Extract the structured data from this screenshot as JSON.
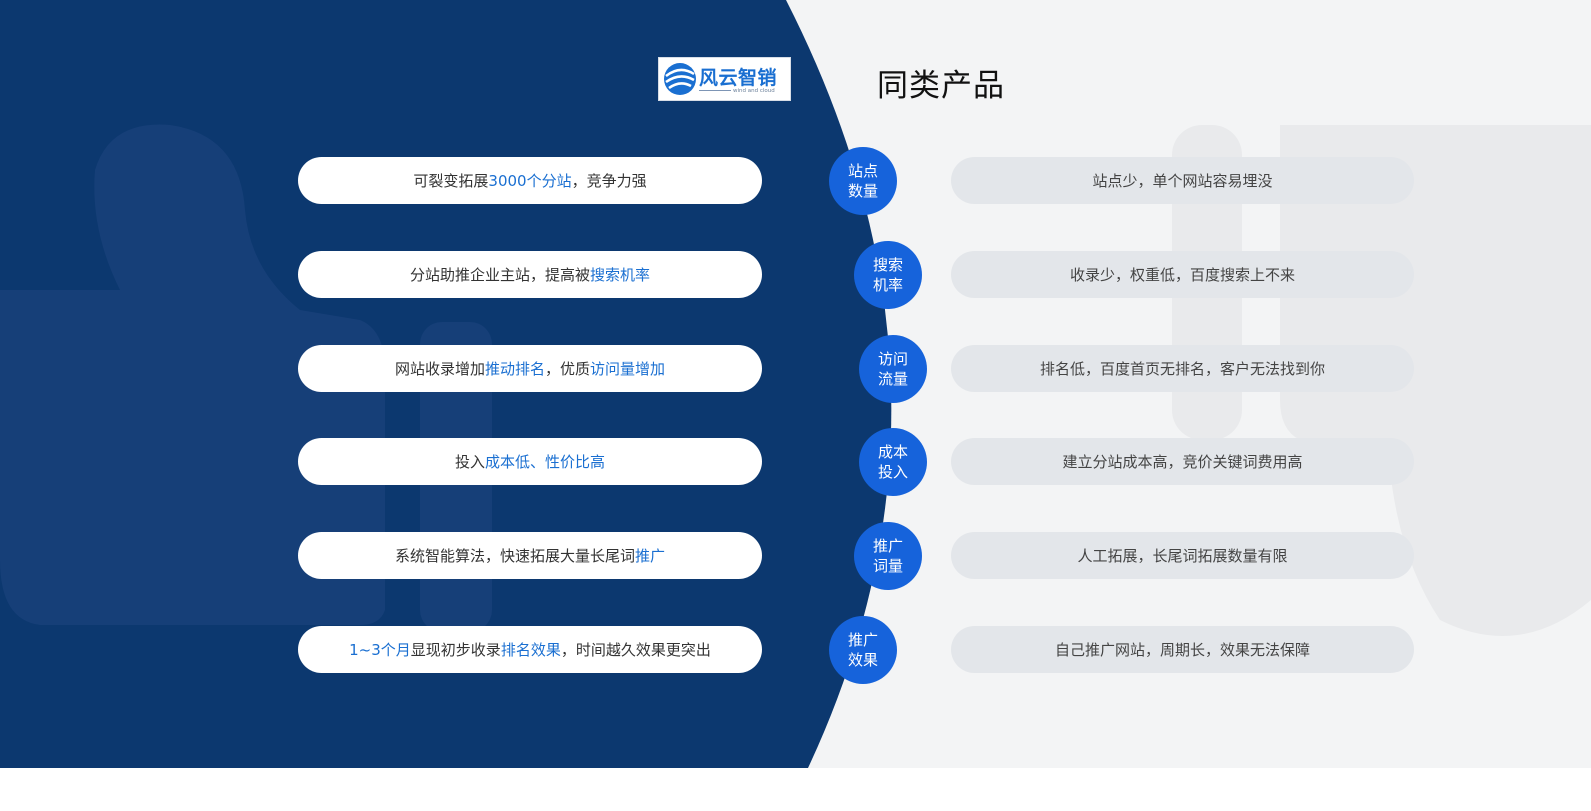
{
  "colors": {
    "dark_panel": "#0c386f",
    "light_panel": "#f3f4f5",
    "accent_blue": "#1663db",
    "highlight_text": "#1a6fd1",
    "right_pill_bg": "#e3e6ea"
  },
  "logo": {
    "icon": "wind-cloud-logo-icon",
    "text": "风云智销",
    "subtext": "wind and cloud"
  },
  "competitor_title": "同类产品",
  "rows": [
    {
      "left": [
        {
          "text": "可裂变拓展",
          "highlight": false
        },
        {
          "text": "3000个分站",
          "highlight": true
        },
        {
          "text": "，竞争力强",
          "highlight": false
        }
      ],
      "badge": [
        "站点",
        "数量"
      ],
      "right": "站点少，单个网站容易埋没"
    },
    {
      "left": [
        {
          "text": "分站助推企业主站，提高被",
          "highlight": false
        },
        {
          "text": "搜索机率",
          "highlight": true
        }
      ],
      "badge": [
        "搜索",
        "机率"
      ],
      "right": "收录少，权重低，百度搜索上不来"
    },
    {
      "left": [
        {
          "text": "网站收录增加",
          "highlight": false
        },
        {
          "text": "推动排名",
          "highlight": true
        },
        {
          "text": "，优质",
          "highlight": false
        },
        {
          "text": "访问量增加",
          "highlight": true
        }
      ],
      "badge": [
        "访问",
        "流量"
      ],
      "right": "排名低，百度首页无排名，客户无法找到你"
    },
    {
      "left": [
        {
          "text": "投入",
          "highlight": false
        },
        {
          "text": "成本低、性价比高",
          "highlight": true
        }
      ],
      "badge": [
        "成本",
        "投入"
      ],
      "right": "建立分站成本高，竞价关键词费用高"
    },
    {
      "left": [
        {
          "text": "系统智能算法，快速拓展大量长尾词",
          "highlight": false
        },
        {
          "text": "推广",
          "highlight": true
        }
      ],
      "badge": [
        "推广",
        "词量"
      ],
      "right": "人工拓展，长尾词拓展数量有限"
    },
    {
      "left": [
        {
          "text": "1~3个月",
          "highlight": true
        },
        {
          "text": "显现初步收录",
          "highlight": false
        },
        {
          "text": "排名效果",
          "highlight": true
        },
        {
          "text": "，时间越久效果更突出",
          "highlight": false
        }
      ],
      "badge": [
        "推广",
        "效果"
      ],
      "right": "自己推广网站，周期长，效果无法保障"
    }
  ]
}
